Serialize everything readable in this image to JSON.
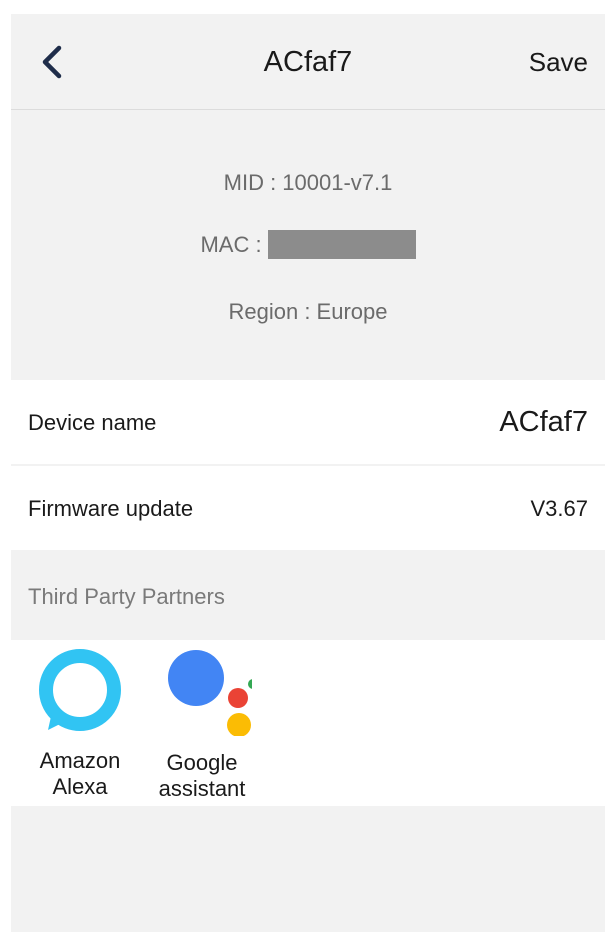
{
  "header": {
    "back_icon": "chevron-left-icon",
    "title": "ACfaf7",
    "save_label": "Save"
  },
  "device_info": {
    "mid": "MID : 10001-v7.1",
    "mac_label": "MAC :",
    "region": "Region : Europe"
  },
  "settings": {
    "device_name": {
      "label": "Device name",
      "value": "ACfaf7"
    },
    "firmware": {
      "label": "Firmware update",
      "value": "V3.67"
    }
  },
  "partners": {
    "section_title": "Third Party Partners",
    "items": [
      {
        "name": "Amazon\nAlexa",
        "icon": "alexa-icon",
        "color": "#31C4F3"
      },
      {
        "name": "Google\nassistant",
        "icon": "google-assistant-icon",
        "colors": [
          "#4285F4",
          "#EA4335",
          "#FBBC04",
          "#34A853"
        ]
      }
    ]
  }
}
